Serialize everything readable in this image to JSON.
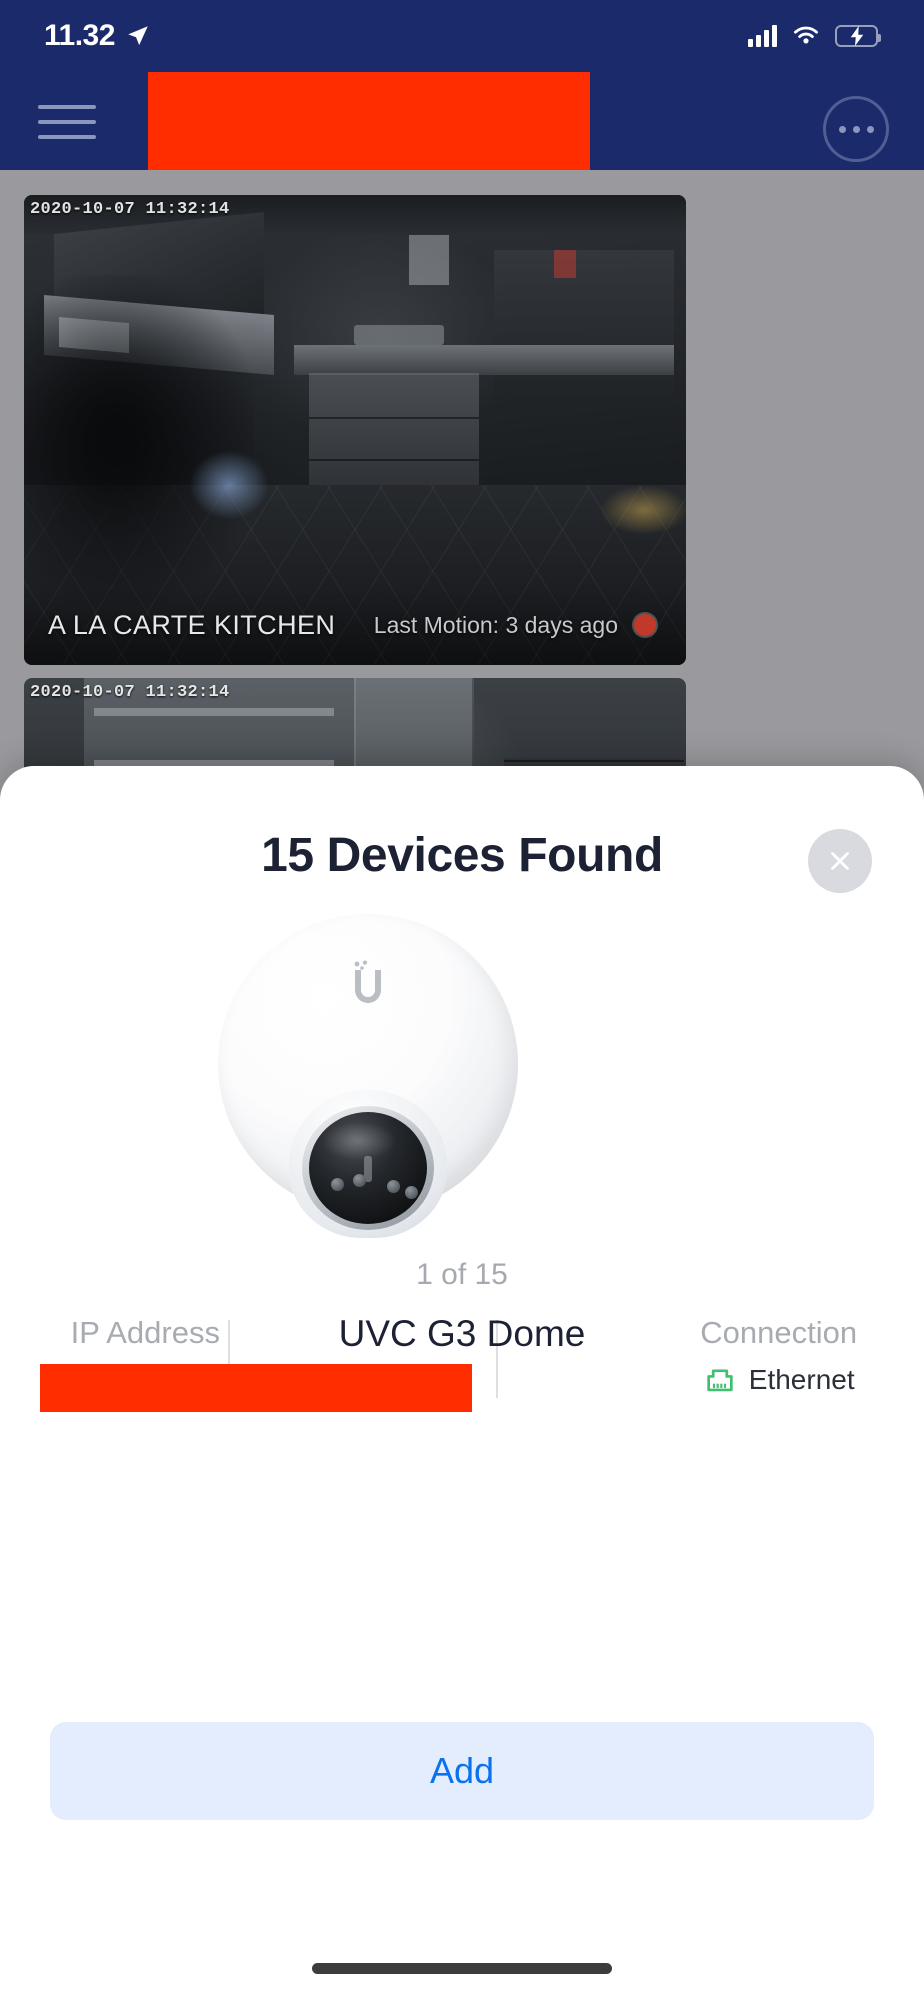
{
  "statusbar": {
    "time": "11.32",
    "location_icon": "location-arrow-icon",
    "signal_icon": "cellular-bars-icon",
    "wifi_icon": "wifi-icon",
    "battery_icon": "battery-charging-icon"
  },
  "navbar": {
    "menu_icon": "hamburger-menu-icon",
    "title_redacted": true,
    "more_icon": "more-options-icon",
    "background_color": "#1b2a6b",
    "redaction_color": "#ff2d00"
  },
  "cameras": [
    {
      "timestamp": "2020-10-07 11:32:14",
      "name": "A LA CARTE KITCHEN",
      "motion": "Last Motion: 3 days ago",
      "record_icon": "record-dot-icon"
    },
    {
      "timestamp": "2020-10-07 11:32:14",
      "name": "",
      "motion": "",
      "record_icon": "record-dot-icon"
    }
  ],
  "sheet": {
    "title": "15 Devices Found",
    "close_icon": "close-icon",
    "device_image_name": "uvc-g3-dome-camera-image",
    "counter": "1 of 15",
    "device_name": "UVC G3 Dome",
    "fields": {
      "ip_label": "IP Address",
      "ip_value": "",
      "ip_redacted": true,
      "connection_label": "Connection",
      "connection_value": "Ethernet",
      "connection_icon": "ethernet-port-icon",
      "connection_icon_color": "#3fbf6f"
    },
    "add_label": "Add",
    "add_color": "#0a72f0",
    "add_background": "#e3edfd"
  },
  "home_indicator": "home-indicator"
}
